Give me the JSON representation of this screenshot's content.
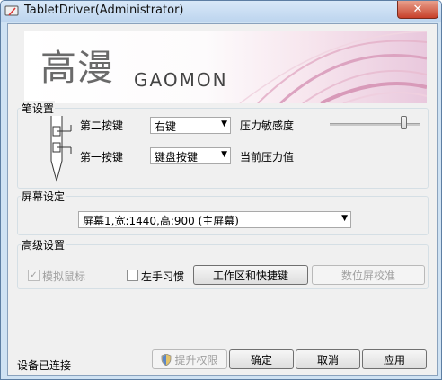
{
  "window": {
    "title": "TabletDriver(Administrator)",
    "close_glyph": "✕"
  },
  "banner": {
    "logo_cn": "高漫",
    "logo_en": "GAOMON"
  },
  "pen_settings": {
    "label": "笔设置",
    "second_key_label": "第二按键",
    "second_key_value": "右键",
    "first_key_label": "第一按键",
    "first_key_value": "键盘按键",
    "pressure_sensitivity_label": "压力敏感度",
    "pressure_sensitivity_level": 0.85,
    "current_pressure_label": "当前压力值"
  },
  "screen_settings": {
    "label": "屏幕设定",
    "screen_value": "屏幕1,宽:1440,高:900 (主屏幕)"
  },
  "advanced": {
    "label": "高级设置",
    "simulate_mouse_label": "模拟鼠标",
    "simulate_mouse_checked": true,
    "left_hand_label": "左手习惯",
    "left_hand_checked": false,
    "work_area_button": "工作区和快捷键",
    "digitizer_calibration_button": "数位屏校准"
  },
  "footer": {
    "status": "设备已连接",
    "elevate_button": "提升权限",
    "ok_button": "确定",
    "cancel_button": "取消",
    "apply_button": "应用"
  },
  "icons": {
    "app": "tablet-icon",
    "shield": "shield-icon"
  },
  "colors": {
    "title_bar": "#bcd4ee",
    "close_button": "#c7402a",
    "banner_accent": "#e9c8dd"
  }
}
